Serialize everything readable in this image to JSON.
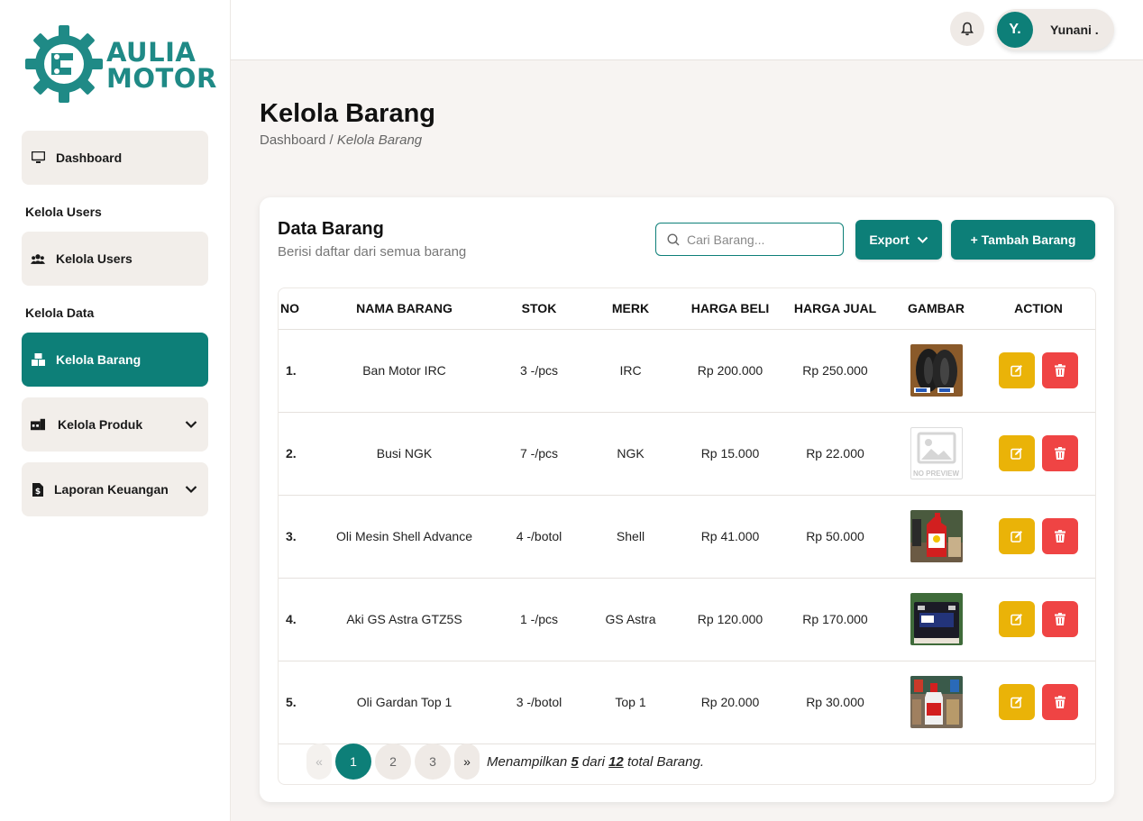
{
  "brand": {
    "logo_line1": "AULIA",
    "logo_line2": "MOTOR",
    "color": "#0d7f78"
  },
  "sidebar": {
    "items": [
      {
        "label": "Dashboard",
        "icon": "monitor-icon"
      },
      {
        "section": "Kelola Users"
      },
      {
        "label": "Kelola Users",
        "icon": "users-icon"
      },
      {
        "section": "Kelola Data"
      },
      {
        "label": "Kelola Barang",
        "icon": "boxes-icon",
        "active": true
      },
      {
        "label": "Kelola Produk",
        "icon": "store-icon",
        "expandable": true
      },
      {
        "label": "Laporan Keuangan",
        "icon": "file-dollar-icon",
        "expandable": true
      }
    ]
  },
  "topbar": {
    "bell_icon": "bell-icon",
    "user_initial": "Y.",
    "user_name": "Yunani ."
  },
  "page": {
    "title": "Kelola Barang",
    "breadcrumb_root": "Dashboard",
    "breadcrumb_sep": " / ",
    "breadcrumb_current": "Kelola Barang"
  },
  "card": {
    "title": "Data Barang",
    "subtitle": "Berisi daftar dari semua barang",
    "search_placeholder": "Cari Barang...",
    "export_label": "Export",
    "add_label": "+ Tambah Barang"
  },
  "table": {
    "headers": [
      "NO",
      "NAMA BARANG",
      "STOK",
      "MERK",
      "HARGA BELI",
      "HARGA JUAL",
      "GAMBAR",
      "ACTION"
    ],
    "rows": [
      {
        "no": "1.",
        "nama": "Ban Motor IRC",
        "stok": "3 -/pcs",
        "merk": "IRC",
        "beli": "Rp 200.000",
        "jual": "Rp 250.000",
        "image": "tire-photo"
      },
      {
        "no": "2.",
        "nama": "Busi NGK",
        "stok": "7 -/pcs",
        "merk": "NGK",
        "beli": "Rp 15.000",
        "jual": "Rp 22.000",
        "image": "no-preview",
        "image_text": "NO PREVIEW"
      },
      {
        "no": "3.",
        "nama": "Oli Mesin Shell Advance",
        "stok": "4 -/botol",
        "merk": "Shell",
        "beli": "Rp 41.000",
        "jual": "Rp 50.000",
        "image": "oil-bottle-photo"
      },
      {
        "no": "4.",
        "nama": "Aki GS Astra GTZ5S",
        "stok": "1 -/pcs",
        "merk": "GS Astra",
        "beli": "Rp 120.000",
        "jual": "Rp 170.000",
        "image": "battery-photo"
      },
      {
        "no": "5.",
        "nama": "Oli Gardan Top 1",
        "stok": "3 -/botol",
        "merk": "Top 1",
        "beli": "Rp 20.000",
        "jual": "Rp 30.000",
        "image": "gear-oil-photo"
      }
    ]
  },
  "pagination": {
    "prev": "«",
    "next": "»",
    "pages": [
      "1",
      "2",
      "3"
    ],
    "current": "1",
    "info_prefix": "Menampilkan ",
    "shown": "5",
    "info_mid": " dari ",
    "total": "12",
    "info_suffix": " total Barang."
  }
}
